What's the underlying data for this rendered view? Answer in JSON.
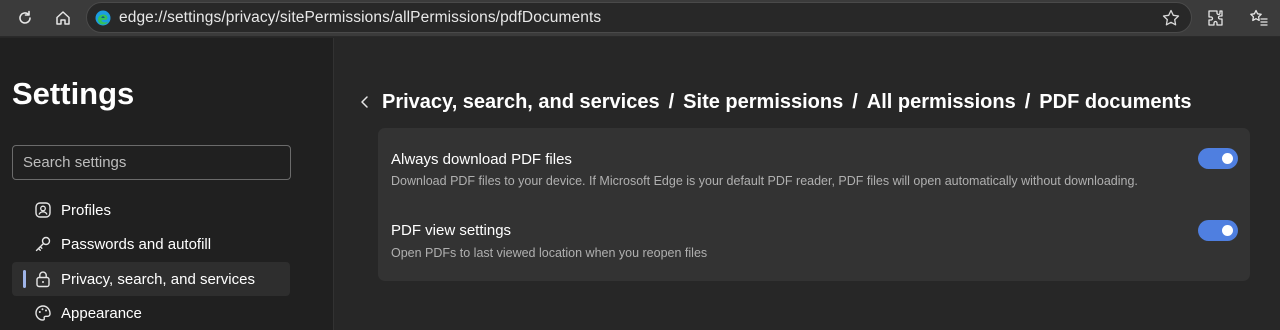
{
  "browser": {
    "address": "edge://settings/privacy/sitePermissions/allPermissions/pdfDocuments"
  },
  "sidebar": {
    "title": "Settings",
    "search_placeholder": "Search settings",
    "items": [
      {
        "label": "Profiles",
        "icon": "profile-icon"
      },
      {
        "label": "Passwords and autofill",
        "icon": "key-icon"
      },
      {
        "label": "Privacy, search, and services",
        "icon": "lock-icon",
        "active": true
      },
      {
        "label": "Appearance",
        "icon": "palette-icon"
      }
    ]
  },
  "main": {
    "breadcrumb": [
      "Privacy, search, and services",
      "Site permissions",
      "All permissions",
      "PDF documents"
    ],
    "separator": "/",
    "settings": [
      {
        "title": "Always download PDF files",
        "description": "Download PDF files to your device. If Microsoft Edge is your default PDF reader, PDF files will open automatically without downloading.",
        "enabled": true
      },
      {
        "title": "PDF view settings",
        "description": "Open PDFs to last viewed location when you reopen files",
        "enabled": true
      }
    ]
  },
  "colors": {
    "accent": "#4f7fe0",
    "active_indicator": "#9fb4e8"
  }
}
